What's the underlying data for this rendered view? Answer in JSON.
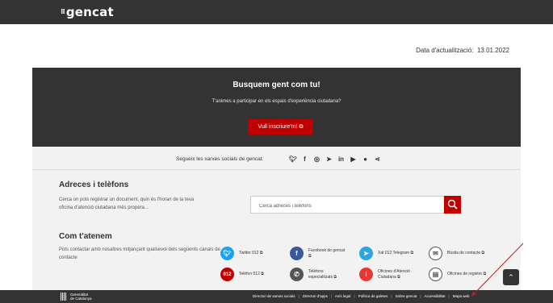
{
  "header": {
    "logo": "gencat"
  },
  "updated": {
    "label": "Data d'actualització:",
    "date": "13.01.2022"
  },
  "promo": {
    "title": "Busquem gent com tu!",
    "subtitle": "T'animes a participar en els espais d'experiència ciutadana?",
    "button": "Vull inscriure'm!"
  },
  "social": {
    "text": "Segueix les xarxes socials de gencat:",
    "icons": [
      "twitter-icon",
      "facebook-icon",
      "instagram-icon",
      "telegram-icon",
      "linkedin-icon",
      "youtube-icon",
      "flickr-icon",
      "share-icon"
    ]
  },
  "addresses": {
    "title": "Adreces i telèfons",
    "description": "Cerca on pots registrar un document, quin és l'horari de la teva oficina d'atenció ciutadana més propera...",
    "search_placeholder": "Cerca adreces i telèfons"
  },
  "contact": {
    "title": "Com t'atenem",
    "description": "Pots contactar amb nosaltres mitjançant qualsevol dels següents canals de contacte",
    "channels": [
      {
        "label": "Twitter 012",
        "icon": "twitter-icon",
        "color": "#1da1f2"
      },
      {
        "label": "Facebook de gencat",
        "icon": "facebook-icon",
        "color": "#3b5998"
      },
      {
        "label": "Xat 012 Telegram",
        "icon": "telegram-icon",
        "color": "#2ca5e0"
      },
      {
        "label": "Bústia de contacte",
        "icon": "mail-icon",
        "color": "#555555"
      },
      {
        "label": "Telèfon 012",
        "icon": "phone-012-icon",
        "color": "#c00000"
      },
      {
        "label": "Telèfons especialitzats",
        "icon": "phone-icon",
        "color": "#555555"
      },
      {
        "label": "Oficines d'Atenció Ciutadana",
        "icon": "info-icon",
        "color": "#e53935"
      },
      {
        "label": "Oficines de registre",
        "icon": "document-icon",
        "color": "#555555"
      }
    ]
  },
  "footer": {
    "logo_line1": "Generalitat",
    "logo_line2": "de Catalunya",
    "links": [
      "Directori de xarxes socials",
      "Directori d'apps",
      "Avís legal",
      "Política de galetes",
      "Sobre gencat",
      "Accessibilitat",
      "Mapa web"
    ]
  },
  "colors": {
    "dark": "#333333",
    "accent": "#c00000",
    "gray_bg": "#f2f2f2"
  }
}
